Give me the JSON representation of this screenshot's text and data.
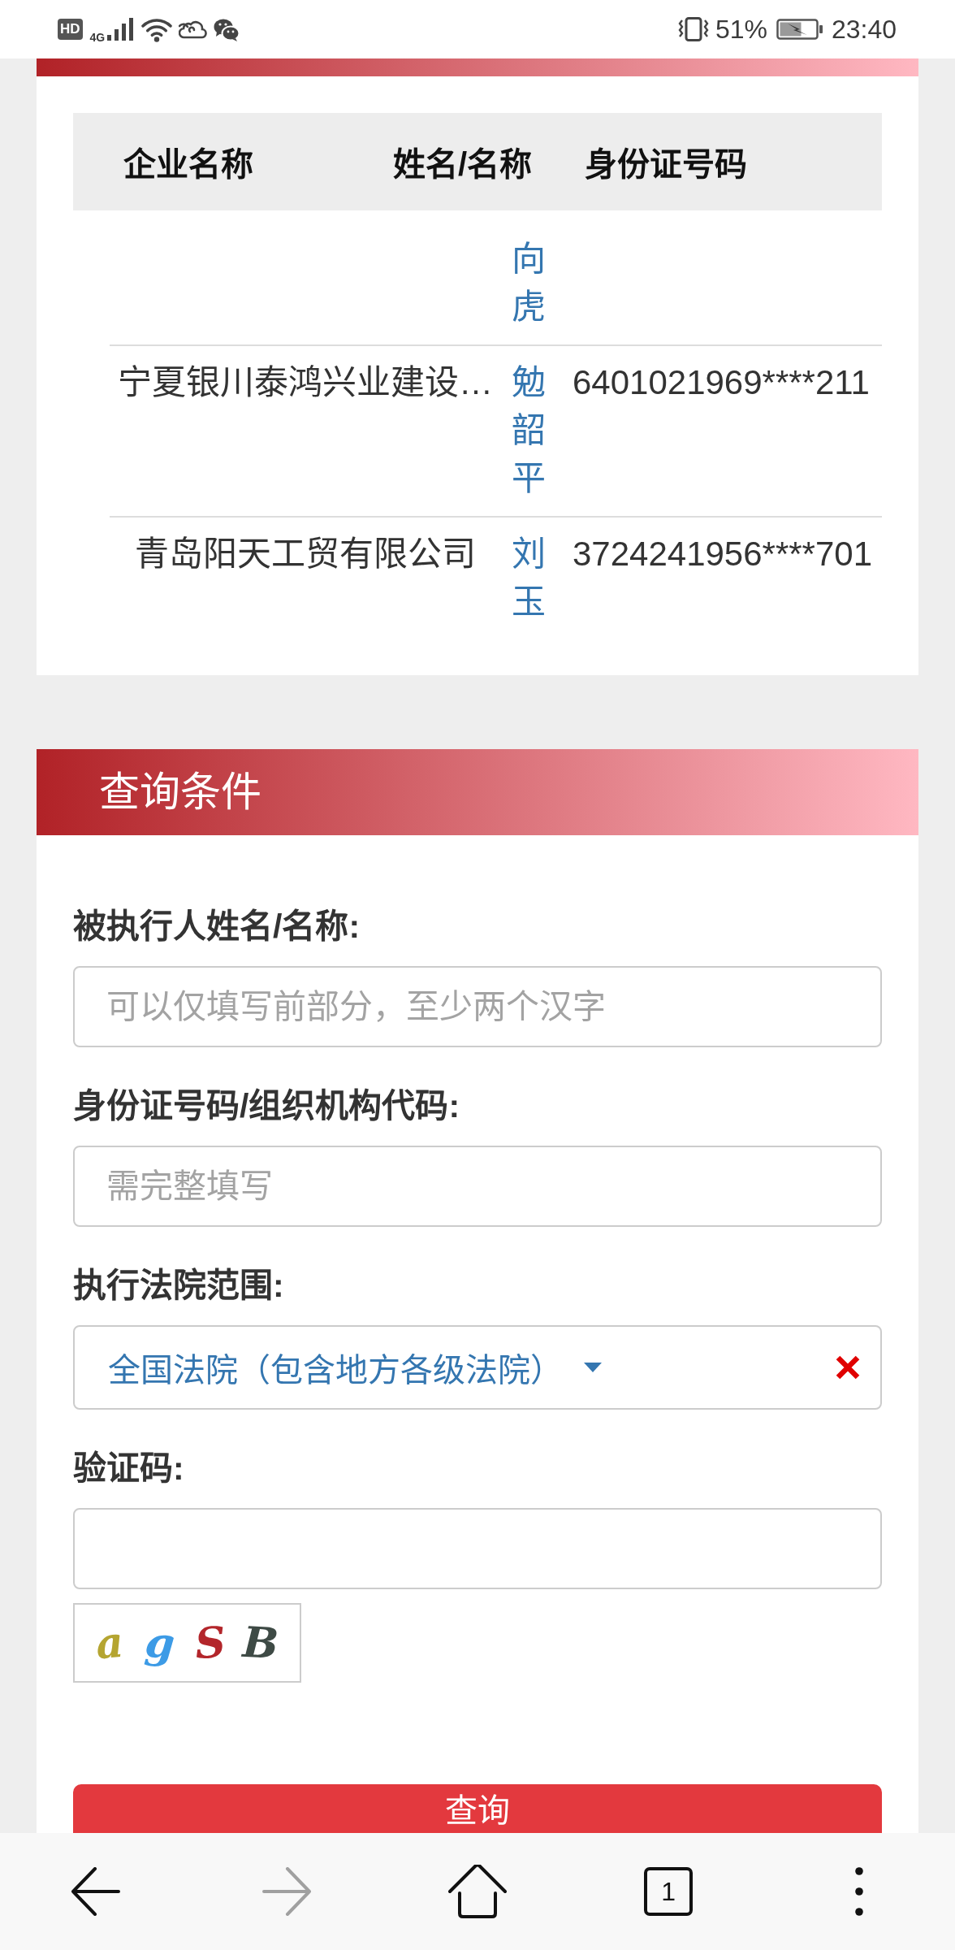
{
  "status_bar": {
    "badge": "HD",
    "network": "4G",
    "battery": "51%",
    "time": "23:40"
  },
  "results": {
    "columns": [
      "企业名称",
      "姓名/名称",
      "身份证号码"
    ],
    "rows": [
      {
        "name": "向虎"
      },
      {
        "company": "宁夏银川泰鸿兴业建设…",
        "name": "勉韶平",
        "id_number": "6401021969****211"
      },
      {
        "company": "青岛阳天工贸有限公司",
        "name": "刘玉",
        "id_number": "3724241956****701"
      }
    ]
  },
  "query": {
    "title": "查询条件",
    "fields": [
      {
        "kind": "text",
        "label": "被执行人姓名/名称:",
        "placeholder": "可以仅填写前部分，至少两个汉字"
      },
      {
        "kind": "text",
        "label": "身份证号码/组织机构代码:",
        "placeholder": "需完整填写"
      },
      {
        "kind": "select",
        "label": "执行法院范围:",
        "value": "全国法院（包含地方各级法院）",
        "clearable": true
      },
      {
        "kind": "captcha",
        "label": "验证码:",
        "captcha": [
          {
            "char": "a",
            "color": "#b5a531"
          },
          {
            "char": "g",
            "color": "#3d9be6"
          },
          {
            "char": "S",
            "color": "#b3262b"
          },
          {
            "char": "B",
            "color": "#3e4a45"
          }
        ]
      }
    ],
    "submit": "查询"
  },
  "nav": {
    "buttons": [
      {
        "kind": "back",
        "disabled": false
      },
      {
        "kind": "forward",
        "disabled": true
      },
      {
        "kind": "home",
        "disabled": false
      },
      {
        "kind": "tabs",
        "disabled": false,
        "count": "1"
      },
      {
        "kind": "menu",
        "disabled": false
      }
    ]
  }
}
